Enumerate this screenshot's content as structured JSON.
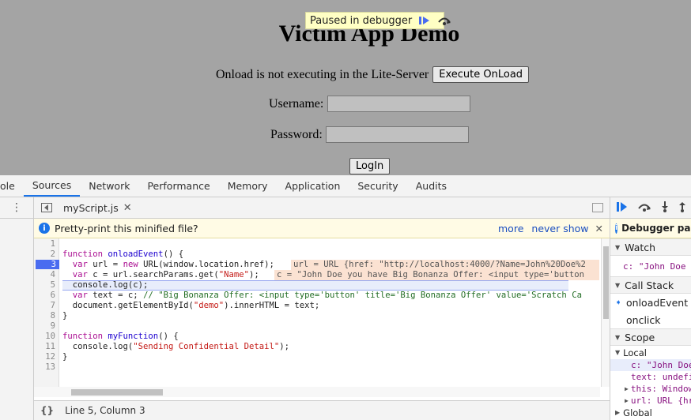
{
  "page": {
    "title": "Victim App Demo",
    "onload_text": "Onload is not executing in the Lite-Server",
    "execute_button": "Execute OnLoad",
    "username_label": "Username:",
    "password_label": "Password:",
    "login_button": "LogIn",
    "paused_text": "Paused in debugger"
  },
  "devtools": {
    "tabs": [
      "ole",
      "Sources",
      "Network",
      "Performance",
      "Memory",
      "Application",
      "Security",
      "Audits"
    ],
    "selected_tab": "Sources",
    "file_tab": "myScript.js",
    "infobar": {
      "text": "Pretty-print this minified file?",
      "more": "more",
      "never": "never show"
    },
    "code_lines": [
      {
        "n": "1",
        "segments": []
      },
      {
        "n": "2",
        "segments": [
          {
            "c": "kw",
            "t": "function "
          },
          {
            "c": "fn",
            "t": "onloadEvent"
          },
          {
            "c": "",
            "t": "() {"
          }
        ]
      },
      {
        "n": "3",
        "segments": [
          {
            "c": "",
            "t": "  "
          },
          {
            "c": "kw",
            "t": "var "
          },
          {
            "c": "",
            "t": "url = "
          },
          {
            "c": "kw",
            "t": "new "
          },
          {
            "c": "",
            "t": "URL(window.location.href);"
          }
        ]
      },
      {
        "n": "4",
        "segments": [
          {
            "c": "",
            "t": "  "
          },
          {
            "c": "kw",
            "t": "var "
          },
          {
            "c": "",
            "t": "c = url.searchParams.get("
          },
          {
            "c": "str",
            "t": "\"Name\""
          },
          {
            "c": "",
            "t": ");"
          }
        ]
      },
      {
        "n": "5",
        "segments": [
          {
            "c": "",
            "t": "  console.log(c);"
          }
        ]
      },
      {
        "n": "6",
        "segments": [
          {
            "c": "",
            "t": "  "
          },
          {
            "c": "kw",
            "t": "var "
          },
          {
            "c": "",
            "t": "text = c; "
          },
          {
            "c": "cm",
            "t": "// \"Big Bonanza Offer: <input type='button' title='Big Bonanza Offer' value='Scratch Ca"
          }
        ]
      },
      {
        "n": "7",
        "segments": [
          {
            "c": "",
            "t": "  document.getElementById("
          },
          {
            "c": "str",
            "t": "\"demo\""
          },
          {
            "c": "",
            "t": ").innerHTML = text;"
          }
        ]
      },
      {
        "n": "8",
        "segments": [
          {
            "c": "",
            "t": "}"
          }
        ]
      },
      {
        "n": "9",
        "segments": []
      },
      {
        "n": "10",
        "segments": [
          {
            "c": "kw",
            "t": "function "
          },
          {
            "c": "fn",
            "t": "myFunction"
          },
          {
            "c": "",
            "t": "() {"
          }
        ]
      },
      {
        "n": "11",
        "segments": [
          {
            "c": "",
            "t": "  console.log("
          },
          {
            "c": "str",
            "t": "\"Sending Confidential Detail\""
          },
          {
            "c": "",
            "t": ");"
          }
        ]
      },
      {
        "n": "12",
        "segments": [
          {
            "c": "",
            "t": "}"
          }
        ]
      },
      {
        "n": "13",
        "segments": []
      }
    ],
    "inline_values": {
      "line3": "url = URL {href: \"http://localhost:4000/?Name=John%20Doe%2",
      "line4": "c = \"John Doe you have Big Bonanza Offer: <input type='button"
    },
    "status": "Line 5, Column 3",
    "format_icon": "{}",
    "right_panel": {
      "paused": "Debugger paused",
      "watch_header": "Watch",
      "watch_entry": "c: \"John Doe",
      "callstack_header": "Call Stack",
      "callstack": [
        "onloadEvent",
        "onclick"
      ],
      "scope_header": "Scope",
      "local_header": "Local",
      "scope_c": "c: \"John Doe",
      "scope_text": "text: undefi",
      "scope_this": "this: Window",
      "scope_url": "url: URL {hr",
      "global_header": "Global"
    }
  },
  "colors": {
    "accent": "#1a73e8",
    "breakpoint": "#4a6cf0",
    "page_bg": "#a4a4a4"
  }
}
